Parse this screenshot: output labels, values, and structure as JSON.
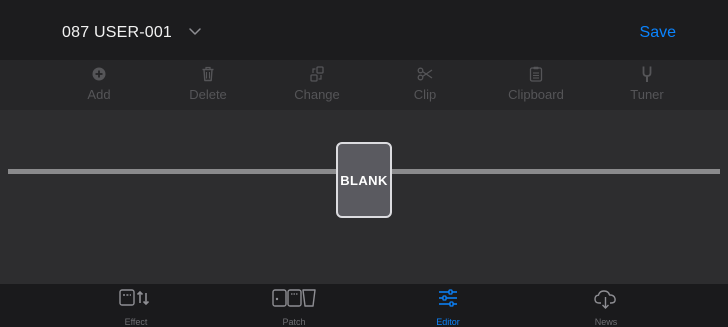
{
  "header": {
    "patch_name": "087 USER-001",
    "save_label": "Save"
  },
  "toolbar": {
    "items": [
      {
        "label": "Add",
        "icon": "plus-circle-icon",
        "enabled": false
      },
      {
        "label": "Delete",
        "icon": "trash-icon",
        "enabled": false
      },
      {
        "label": "Change",
        "icon": "swap-icon",
        "enabled": false
      },
      {
        "label": "Clip",
        "icon": "scissors-icon",
        "enabled": false
      },
      {
        "label": "Clipboard",
        "icon": "clipboard-icon",
        "enabled": false
      },
      {
        "label": "Tuner",
        "icon": "tuning-fork-icon",
        "enabled": false
      }
    ]
  },
  "editor": {
    "slot_label": "BLANK"
  },
  "tabbar": {
    "items": [
      {
        "label": "Effect",
        "icon": "effect-icon",
        "active": false
      },
      {
        "label": "Patch",
        "icon": "patch-icon",
        "active": false
      },
      {
        "label": "Editor",
        "icon": "editor-sliders-icon",
        "active": true
      },
      {
        "label": "News",
        "icon": "cloud-download-icon",
        "active": false
      }
    ]
  },
  "colors": {
    "accent": "#0a84ff",
    "disabled": "#555558",
    "tab_inactive": "#6e6e72"
  }
}
